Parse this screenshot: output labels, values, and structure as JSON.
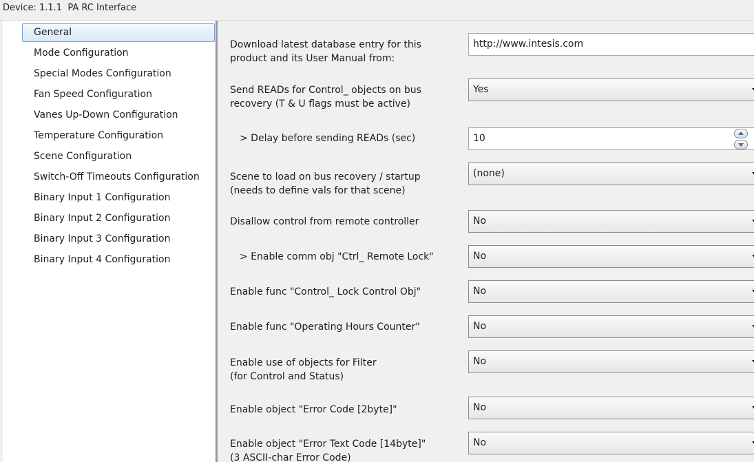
{
  "window": {
    "title": "Device: 1.1.1  PA RC Interface"
  },
  "sidebar": {
    "items": [
      {
        "label": "General",
        "selected": true
      },
      {
        "label": "Mode Configuration"
      },
      {
        "label": "Special Modes Configuration"
      },
      {
        "label": "Fan Speed Configuration"
      },
      {
        "label": "Vanes Up-Down Configuration"
      },
      {
        "label": "Temperature Configuration"
      },
      {
        "label": "Scene Configuration"
      },
      {
        "label": "Switch-Off Timeouts Configuration"
      },
      {
        "label": "Binary Input 1 Configuration"
      },
      {
        "label": "Binary Input 2 Configuration"
      },
      {
        "label": "Binary Input 3 Configuration"
      },
      {
        "label": "Binary Input 4 Configuration"
      }
    ]
  },
  "params": [
    {
      "label": "Download latest database entry for this\nproduct and its User Manual from:",
      "value": "http://www.intesis.com",
      "control": "text"
    },
    {
      "label": "Send READs for Control_ objects on bus\nrecovery (T & U flags must be active)",
      "value": "Yes",
      "control": "dropdown"
    },
    {
      "label": "> Delay before sending READs (sec)",
      "value": "10",
      "control": "spinner"
    },
    {
      "label": "Scene to load on bus recovery / startup\n(needs to define vals for that scene)",
      "value": "(none)",
      "control": "dropdown"
    },
    {
      "label": "Disallow control from remote controller",
      "value": "No",
      "control": "dropdown"
    },
    {
      "label": "> Enable comm obj \"Ctrl_ Remote Lock\"",
      "value": "No",
      "control": "dropdown"
    },
    {
      "label": "Enable func \"Control_ Lock Control Obj\"",
      "value": "No",
      "control": "dropdown"
    },
    {
      "label": "Enable func \"Operating Hours Counter\"",
      "value": "No",
      "control": "dropdown"
    },
    {
      "label": "Enable use of objects for Filter\n(for Control and Status)",
      "value": "No",
      "control": "dropdown"
    },
    {
      "label": "Enable object \"Error Code [2byte]\"",
      "value": "No",
      "control": "dropdown"
    },
    {
      "label": "Enable object \"Error Text Code [14byte]\"\n(3 ASCII-char Error Code)",
      "value": "No",
      "control": "dropdown"
    }
  ],
  "icons": {
    "dropdown": "chevron-down-icon",
    "spinner_up": "spin-up-icon",
    "spinner_down": "spin-down-icon"
  },
  "colors": {
    "selection_border": "#7da2ce",
    "selection_fill": "#d9e8f8",
    "panel_bg": "#f0f0f0",
    "spinner_arrow": "#3a6ea5"
  }
}
